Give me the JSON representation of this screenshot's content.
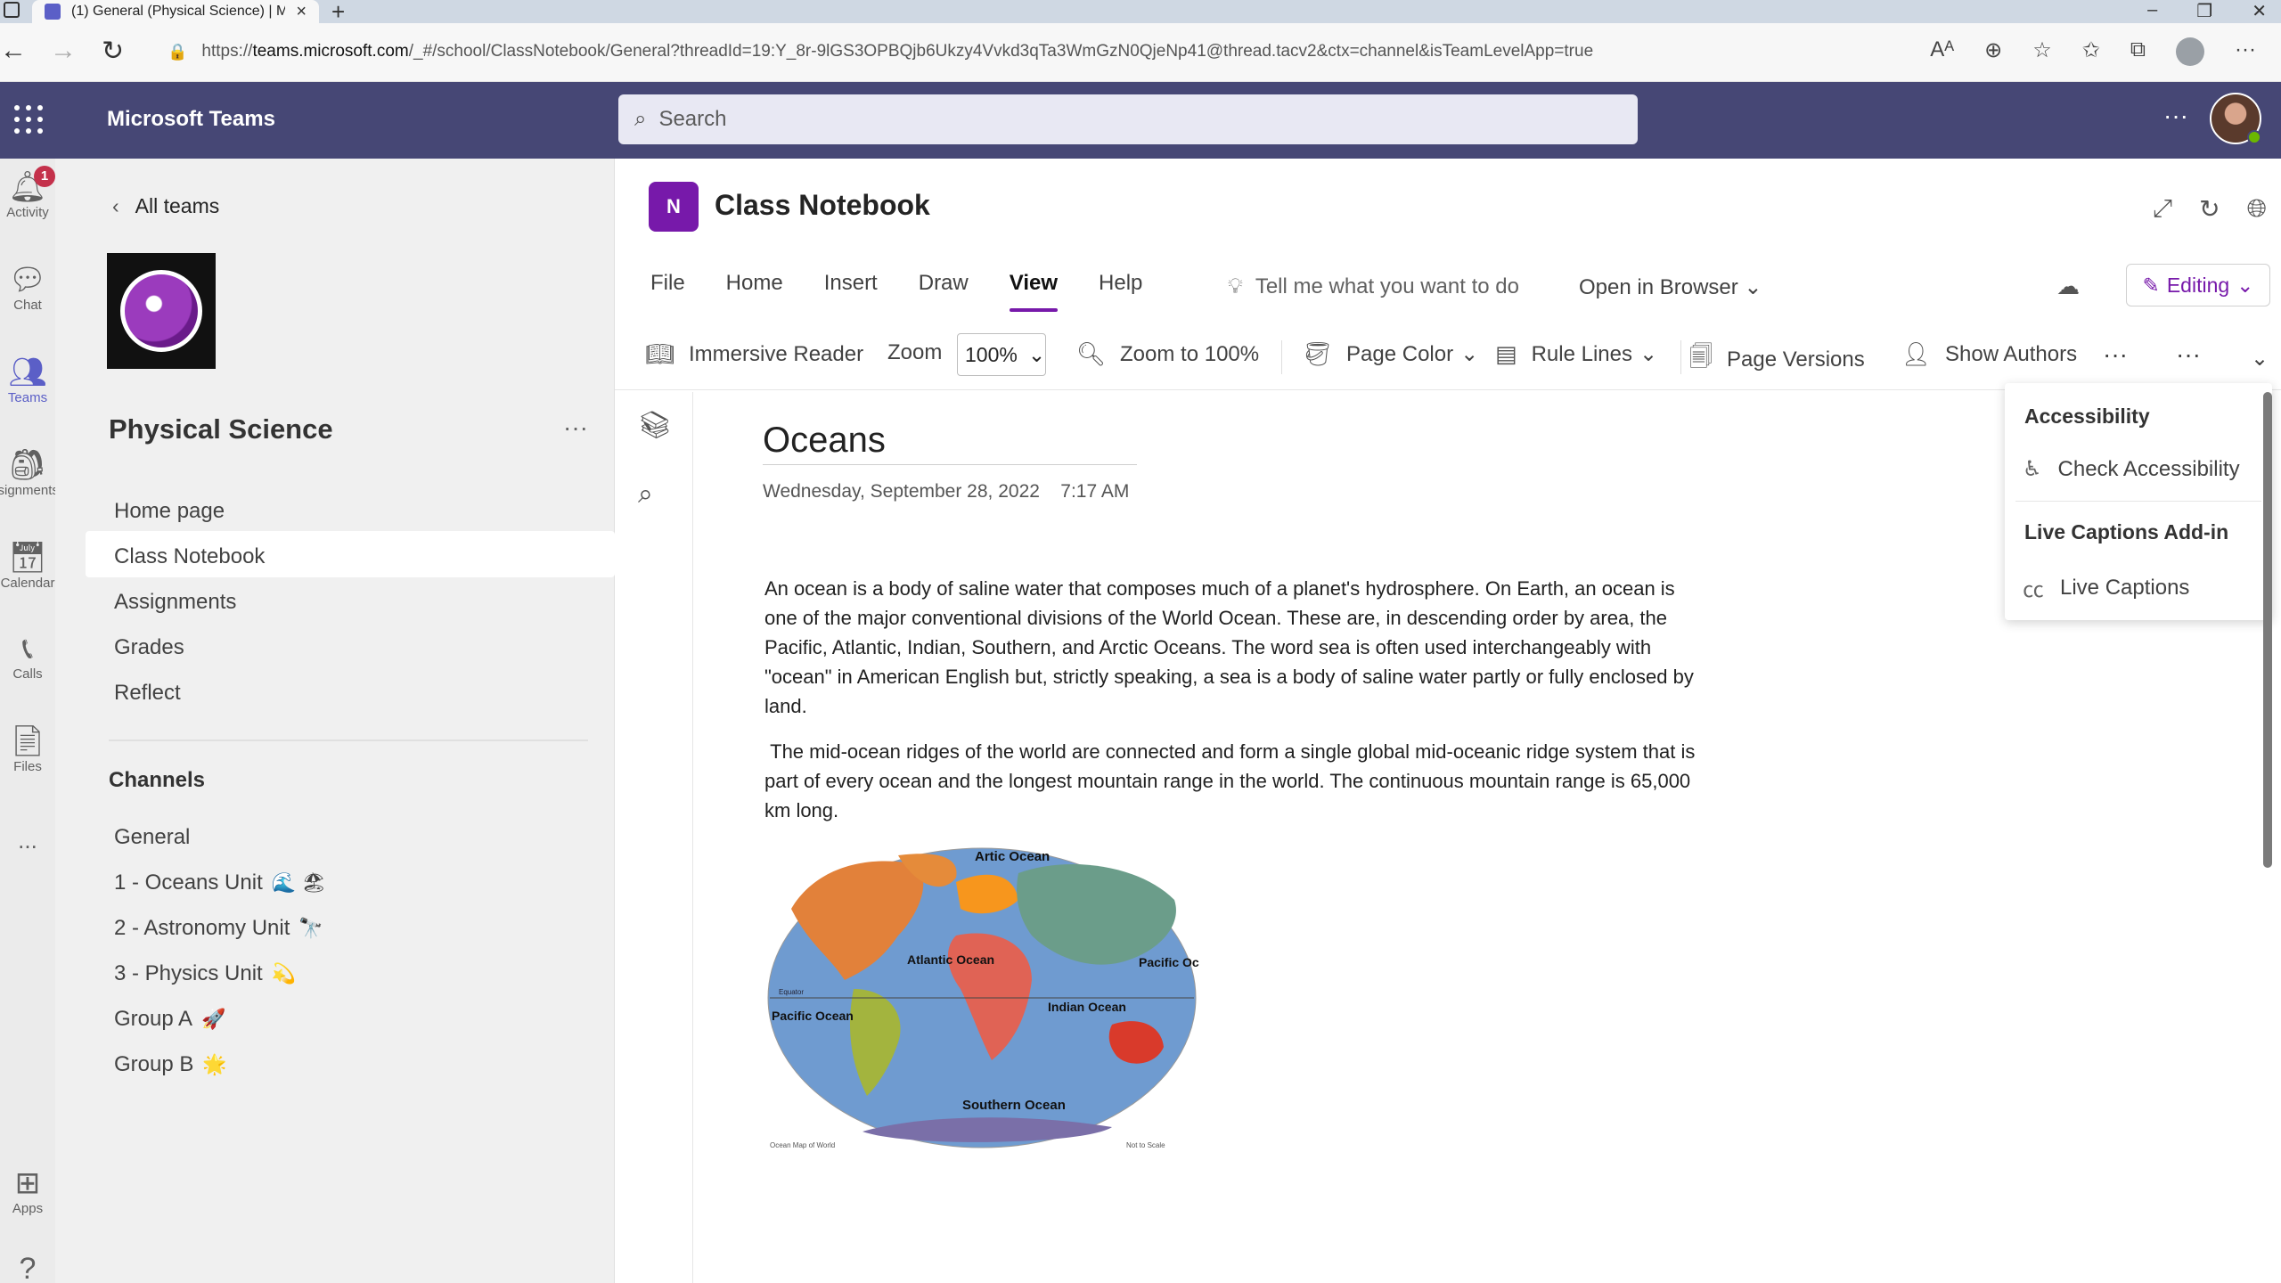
{
  "browser": {
    "tab_title": "(1) General (Physical Science) | M",
    "url_prefix": "https://",
    "url_host": "teams.microsoft.com",
    "url_rest": "/_#/school/ClassNotebook/General?threadId=19:Y_8r-9lGS3OPBQjb6Ukzy4Vvkd3qTa3WmGzN0QjeNp41@thread.tacv2&ctx=channel&isTeamLevelApp=true"
  },
  "teams": {
    "app_name": "Microsoft Teams",
    "search_placeholder": "Search"
  },
  "rail": {
    "items": [
      {
        "label": "Activity",
        "badge": "1"
      },
      {
        "label": "Chat"
      },
      {
        "label": "Teams"
      },
      {
        "label": "Assignments"
      },
      {
        "label": "Calendar"
      },
      {
        "label": "Calls"
      },
      {
        "label": "Files"
      },
      {
        "label": "..."
      },
      {
        "label": "Apps"
      }
    ]
  },
  "team_panel": {
    "back_label": "All teams",
    "team_name": "Physical Science",
    "nav": [
      "Home page",
      "Class Notebook",
      "Assignments",
      "Grades",
      "Reflect"
    ],
    "channels_header": "Channels",
    "channels": [
      {
        "name": "General",
        "emoji": ""
      },
      {
        "name": "1 - Oceans Unit",
        "emoji": "🌊 🏖"
      },
      {
        "name": "2 - Astronomy Unit",
        "emoji": "🔭"
      },
      {
        "name": "3 - Physics Unit",
        "emoji": "💫"
      },
      {
        "name": "Group A",
        "emoji": "🚀"
      },
      {
        "name": "Group B",
        "emoji": "🌟"
      }
    ]
  },
  "notebook": {
    "icon_text": "N",
    "title": "Class Notebook",
    "ribbon_tabs": [
      "File",
      "Home",
      "Insert",
      "Draw",
      "View",
      "Help"
    ],
    "active_tab": "View",
    "tell_me": "Tell me what you want to do",
    "open_in_browser": "Open in Browser",
    "editing": "Editing",
    "toolbar": {
      "immersive_reader": "Immersive Reader",
      "zoom_label": "Zoom",
      "zoom_value": "100%",
      "zoom_to_100": "Zoom to 100%",
      "page_color": "Page Color",
      "rule_lines": "Rule Lines",
      "page_versions": "Page Versions",
      "show_authors": "Show Authors"
    }
  },
  "page": {
    "title": "Oceans",
    "date": "Wednesday, September 28, 2022",
    "time": "7:17 AM",
    "paragraph1": "An ocean is a body of saline water that composes much of a planet's hydrosphere. On Earth, an ocean is one of the major conventional divisions of the World Ocean. These are, in descending order by area, the Pacific, Atlantic, Indian, Southern, and Arctic Oceans. The word sea is often used interchangeably with \"ocean\" in American English but, strictly speaking, a sea is a body of saline water partly or fully enclosed by land.",
    "paragraph2": " The mid-ocean ridges of the world are connected and form a single global mid-oceanic ridge system that is part of every ocean and the longest mountain range in the world. The continuous mountain range is 65,000 km long.",
    "map_labels": {
      "arctic": "Artic Ocean",
      "atlantic": "Atlantic Ocean",
      "pacific_e": "Pacific Ocean",
      "pacific_w": "Pacific Ocean",
      "indian": "Indian Ocean",
      "southern": "Southern Ocean",
      "equator": "Equator",
      "caption_left": "Ocean Map of World",
      "caption_right": "Not to Scale"
    }
  },
  "dropdown": {
    "accessibility_header": "Accessibility",
    "check_accessibility": "Check Accessibility",
    "captions_header": "Live Captions Add-in",
    "live_captions": "Live Captions"
  }
}
